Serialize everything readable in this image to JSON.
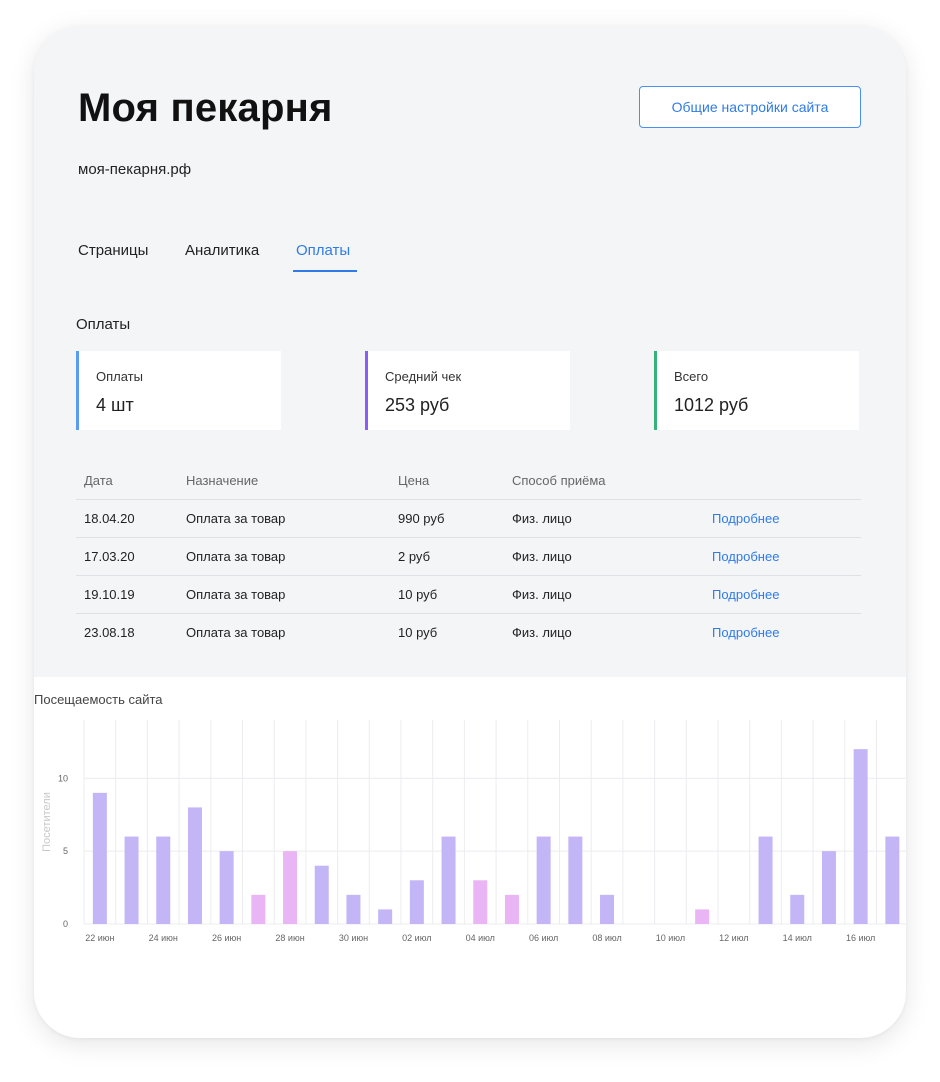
{
  "site": {
    "title": "Моя пекарня",
    "url": "моя-пекарня.рф",
    "settings_button": "Общие настройки сайта"
  },
  "tabs": [
    {
      "label": "Страницы",
      "active": false
    },
    {
      "label": "Аналитика",
      "active": false
    },
    {
      "label": "Оплаты",
      "active": true
    }
  ],
  "payments": {
    "section_title": "Оплаты",
    "stats": [
      {
        "label": "Оплаты",
        "value": "4 шт",
        "color": "#5b9cf0"
      },
      {
        "label": "Средний чек",
        "value": "253 руб",
        "color": "#8b5cf6"
      },
      {
        "label": "Всего",
        "value": "1012 руб",
        "color": "#34b27a"
      }
    ],
    "table": {
      "headers": [
        "Дата",
        "Назначение",
        "Цена",
        "Способ приёма",
        ""
      ],
      "rows": [
        {
          "date": "18.04.20",
          "purpose": "Оплата за товар",
          "price": "990 руб",
          "method": "Физ. лицо",
          "link": "Подробнее"
        },
        {
          "date": "17.03.20",
          "purpose": "Оплата за товар",
          "price": "2 руб",
          "method": "Физ. лицо",
          "link": "Подробнее"
        },
        {
          "date": "19.10.19",
          "purpose": "Оплата за товар",
          "price": "10 руб",
          "method": "Физ. лицо",
          "link": "Подробнее"
        },
        {
          "date": "23.08.18",
          "purpose": "Оплата за товар",
          "price": "10 руб",
          "method": "Физ. лицо",
          "link": "Подробнее"
        }
      ]
    }
  },
  "chart_data": {
    "type": "bar",
    "title": "Посещаемость сайта",
    "ylabel": "Посетители",
    "xlabel": "",
    "ylim": [
      0,
      14
    ],
    "yticks": [
      0,
      5,
      10
    ],
    "grid": true,
    "categories": [
      "22 июн",
      "23 июн",
      "24 июн",
      "25 июн",
      "26 июн",
      "27 июн",
      "28 июн",
      "29 июн",
      "30 июн",
      "01 июл",
      "02 июл",
      "03 июл",
      "04 июл",
      "05 июл",
      "06 июл",
      "07 июл",
      "08 июл",
      "09 июл",
      "10 июл",
      "11 июл",
      "12 июл",
      "13 июл",
      "14 июл",
      "15 июл",
      "16 июл",
      "17 июл"
    ],
    "x_tick_labels": [
      "22 июн",
      "24 июн",
      "26 июн",
      "28 июн",
      "30 июн",
      "02 июл",
      "04 июл",
      "06 июл",
      "08 июл",
      "10 июл",
      "12 июл",
      "14 июл",
      "16 июл"
    ],
    "values": [
      9,
      6,
      6,
      8,
      5,
      2,
      5,
      4,
      2,
      1,
      3,
      6,
      3,
      2,
      6,
      6,
      2,
      0,
      0,
      1,
      0,
      6,
      2,
      5,
      12,
      6
    ],
    "highlight": [
      false,
      false,
      false,
      false,
      false,
      true,
      true,
      false,
      false,
      false,
      false,
      false,
      true,
      true,
      false,
      false,
      false,
      false,
      false,
      true,
      false,
      false,
      false,
      false,
      false,
      false
    ],
    "colors": {
      "bar": "#c4b5f7",
      "highlight": "#e9b5f5",
      "grid": "#ececf0",
      "axis_text": "#666666"
    }
  }
}
